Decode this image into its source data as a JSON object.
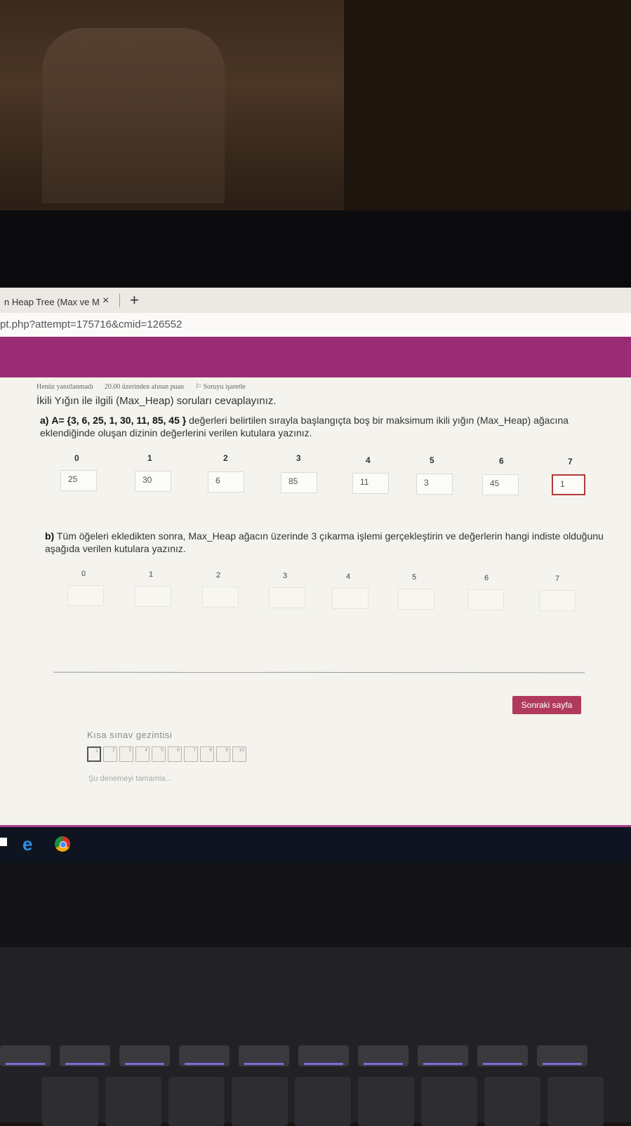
{
  "browser": {
    "tab_title": "n Heap Tree (Max ve M",
    "tab_close": "×",
    "new_tab": "+",
    "url": "pt.php?attempt=175716&cmid=126552"
  },
  "question": {
    "status": "Henüz yanıtlanmadı",
    "points": "20.00 üzerinden alınan puan",
    "flag": "Soruyu işaretle",
    "title": "İkili Yığın ile ilgili (Max_Heap) soruları cevaplayınız.",
    "part_a_label": "a)",
    "part_a_set": "A= {3, 6, 25, 1, 30, 11, 85, 45 }",
    "part_a_text": " değerleri belirtilen sırayla başlangıçta boş bir maksimum ikili yığın (Max_Heap) ağacına eklendiğinde oluşan dizinin değerlerini verilen kutulara yazınız.",
    "part_a_indices": [
      "0",
      "1",
      "2",
      "3",
      "4",
      "5",
      "6",
      "7"
    ],
    "part_a_values": [
      "25",
      "30",
      "6",
      "85",
      "11",
      "3",
      "45",
      "1"
    ],
    "part_b_label": "b)",
    "part_b_text": " Tüm öğeleri ekledikten sonra, Max_Heap ağacın üzerinde 3 çıkarma işlemi gerçekleştirin ve değerlerin hangi indiste olduğunu aşağıda verilen kutulara yazınız.",
    "part_b_indices": [
      "0",
      "1",
      "2",
      "3",
      "4",
      "5",
      "6",
      "7"
    ]
  },
  "buttons": {
    "next_page": "Sonraki sayfa"
  },
  "navigation": {
    "title": "Kısa sınav gezintisi",
    "items": [
      "1",
      "2",
      "3",
      "4",
      "5",
      "6",
      "7",
      "8",
      "9",
      "10"
    ],
    "finish_link": "Şu denemeyi tamamla..."
  },
  "taskbar": {
    "ie_glyph": "e"
  },
  "colors": {
    "accent": "#9a2c74",
    "button": "#b03a5c"
  }
}
